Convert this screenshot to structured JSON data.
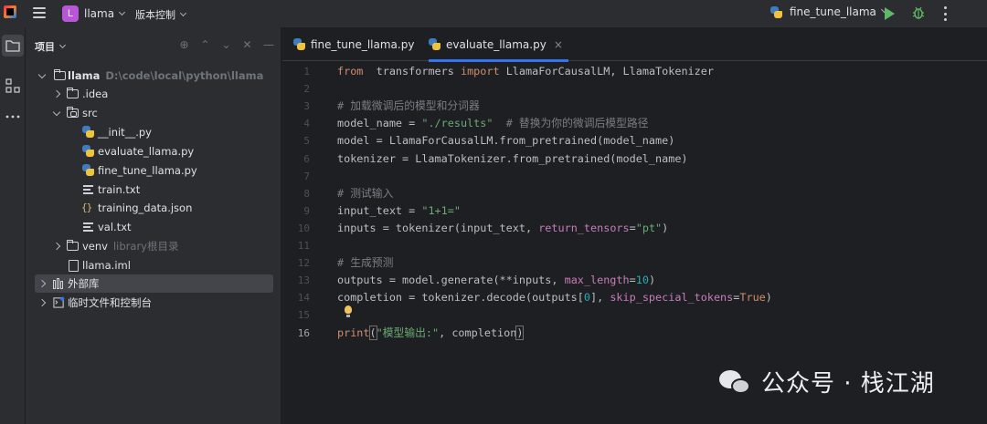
{
  "titlebar": {
    "project_initial": "L",
    "project_name": "llama",
    "vcs_label": "版本控制",
    "run_config": "fine_tune_llama"
  },
  "panel": {
    "title": "项目",
    "tree": [
      {
        "label": "llama",
        "hint": "D:\\code\\local\\python\\llama",
        "type": "folder",
        "expanded": true
      },
      {
        "label": ".idea",
        "type": "folder",
        "expanded": false
      },
      {
        "label": "src",
        "type": "folder",
        "expanded": true
      },
      {
        "label": "__init__.py",
        "type": "python"
      },
      {
        "label": "evaluate_llama.py",
        "type": "python"
      },
      {
        "label": "fine_tune_llama.py",
        "type": "python"
      },
      {
        "label": "train.txt",
        "type": "text"
      },
      {
        "label": "training_data.json",
        "type": "json"
      },
      {
        "label": "val.txt",
        "type": "text"
      },
      {
        "label": "venv",
        "hint": "library根目录",
        "type": "folder",
        "expanded": false
      },
      {
        "label": "llama.iml",
        "type": "iml"
      },
      {
        "label": "外部库",
        "type": "library",
        "expanded": false,
        "selected": true
      },
      {
        "label": "临时文件和控制台",
        "type": "scratches",
        "expanded": false
      }
    ]
  },
  "tabs": [
    {
      "label": "fine_tune_llama.py",
      "active": false
    },
    {
      "label": "evaluate_llama.py",
      "active": true,
      "close": "×"
    }
  ],
  "editor": {
    "current_line": 16,
    "line_numbers": [
      "1",
      "2",
      "3",
      "4",
      "5",
      "6",
      "7",
      "8",
      "9",
      "10",
      "11",
      "12",
      "13",
      "14",
      "15",
      "16"
    ],
    "lines": [
      [
        [
          "kw",
          "from"
        ],
        [
          "",
          "  transformers "
        ],
        [
          "kw",
          "import"
        ],
        [
          "",
          " LlamaForCausalLM, LlamaTokenizer"
        ]
      ],
      [],
      [
        [
          "cmt",
          "# 加载微调后的模型和分词器"
        ]
      ],
      [
        [
          "",
          "model_name = "
        ],
        [
          "str",
          "\"./results\""
        ],
        [
          "",
          "  "
        ],
        [
          "cmt",
          "# 替换为你的微调后模型路径"
        ]
      ],
      [
        [
          "",
          "model = LlamaForCausalLM.from_pretrained(model_name)"
        ]
      ],
      [
        [
          "",
          "tokenizer = LlamaTokenizer.from_pretrained(model_name)"
        ]
      ],
      [],
      [
        [
          "cmt",
          "# 测试输入"
        ]
      ],
      [
        [
          "",
          "input_text = "
        ],
        [
          "str",
          "\"1+1=\""
        ]
      ],
      [
        [
          "",
          "inputs = tokenizer(input_text, "
        ],
        [
          "param",
          "return_tensors"
        ],
        [
          "",
          "="
        ],
        [
          "str",
          "\"pt\""
        ],
        [
          "",
          ")"
        ]
      ],
      [],
      [
        [
          "cmt",
          "# 生成预测"
        ]
      ],
      [
        [
          "",
          "outputs = model.generate(**inputs, "
        ],
        [
          "param",
          "max_length"
        ],
        [
          "",
          "="
        ],
        [
          "num",
          "10"
        ],
        [
          "",
          ")"
        ]
      ],
      [
        [
          "",
          "completion = tokenizer.decode(outputs["
        ],
        [
          "num",
          "0"
        ],
        [
          "",
          "], "
        ],
        [
          "param",
          "skip_special_tokens"
        ],
        [
          "",
          "="
        ],
        [
          "kw",
          "True"
        ],
        [
          "",
          ")"
        ]
      ],
      [],
      [
        [
          "kw",
          "print"
        ],
        [
          "hl",
          "("
        ],
        [
          "str",
          "\"模型输出:\""
        ],
        [
          "",
          ", completion"
        ],
        [
          "hl",
          ")"
        ]
      ]
    ]
  },
  "watermark": {
    "text": "公众号 · 栈江湖"
  },
  "colors": {
    "accent": "#3574f0",
    "run_green": "#5fb865",
    "project_badge": "#b757d6"
  }
}
